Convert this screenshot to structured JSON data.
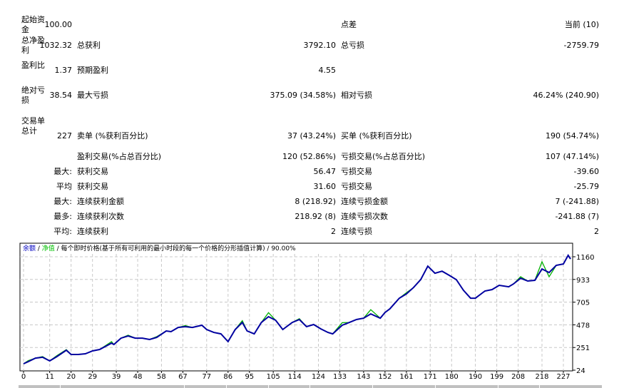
{
  "rows": [
    {
      "l1": "起始资金",
      "v1": "100.00",
      "l2": "",
      "v2": "",
      "l3": "点差",
      "v3": "当前 (10)"
    },
    {
      "l1": "总净盈利",
      "v1": "1032.32",
      "l2": "总获利",
      "v2": "3792.10",
      "l3": "总亏损",
      "v3": "-2759.79"
    },
    {
      "l1": "盈利比",
      "v1": "1.37",
      "l2": "预期盈利",
      "v2": "4.55",
      "l3": "",
      "v3": ""
    },
    {
      "l1": "绝对亏损",
      "v1": "38.54",
      "l2": "最大亏损",
      "v2": "375.09 (34.58%)",
      "l3": "相对亏损",
      "v3": "46.24% (240.90)"
    },
    {
      "l1": "交易单总计",
      "v1": "227",
      "l2": "卖单 (%获利百分比)",
      "v2": "37 (43.24%)",
      "l3": "买单 (%获利百分比)",
      "v3": "190 (54.74%)"
    },
    {
      "l1": "",
      "v1": "",
      "l2": "盈利交易(%占总百分比)",
      "v2": "120 (52.86%)",
      "l3": "亏损交易(%占总百分比)",
      "v3": "107 (47.14%)"
    },
    {
      "l1": "",
      "v1": "最大:",
      "l2": "获利交易",
      "v2": "56.47",
      "l3": "亏损交易",
      "v3": "-39.60"
    },
    {
      "l1": "",
      "v1": "平均",
      "l2": "获利交易",
      "v2": "31.60",
      "l3": "亏损交易",
      "v3": "-25.79"
    },
    {
      "l1": "",
      "v1": "最大:",
      "l2": "连续获利金额",
      "v2": "8 (218.92)",
      "l3": "连续亏损金额",
      "v3": "7 (-241.88)"
    },
    {
      "l1": "",
      "v1": "最多:",
      "l2": "连续获利次数",
      "v2": "218.92 (8)",
      "l3": "连续亏损次数",
      "v3": "-241.88 (7)"
    },
    {
      "l1": "",
      "v1": "平均:",
      "l2": "连续获利",
      "v2": "2",
      "l3": "连续亏损",
      "v3": "2"
    }
  ],
  "chart_data": {
    "type": "line",
    "legend": {
      "balance": "余额",
      "sep": " / ",
      "equity": "净值",
      "desc": " / 每个即时价格(基于所有可利用的最小时段的每一个价格的分形插值计算) / 90.00%"
    },
    "colors": {
      "balance": "#0000a0",
      "equity": "#00b000",
      "legend_balance": "#0000c0",
      "legend_equity": "#00c000"
    },
    "xticks": [
      0,
      11,
      20,
      29,
      39,
      48,
      58,
      67,
      77,
      86,
      95,
      105,
      114,
      124,
      133,
      143,
      152,
      161,
      171,
      180,
      190,
      199,
      208,
      218,
      227
    ],
    "yticks": [
      24,
      251,
      478,
      705,
      933,
      1160
    ],
    "xlim": [
      -1,
      230
    ],
    "ylim": [
      24,
      1190
    ],
    "balance": [
      [
        0,
        88
      ],
      [
        2,
        110
      ],
      [
        5,
        145
      ],
      [
        8,
        153
      ],
      [
        11,
        117
      ],
      [
        14,
        160
      ],
      [
        18,
        224
      ],
      [
        20,
        181
      ],
      [
        23,
        181
      ],
      [
        26,
        188
      ],
      [
        29,
        217
      ],
      [
        32,
        231
      ],
      [
        37,
        295
      ],
      [
        38,
        281
      ],
      [
        41,
        345
      ],
      [
        44,
        367
      ],
      [
        47,
        345
      ],
      [
        50,
        345
      ],
      [
        53,
        331
      ],
      [
        56,
        352
      ],
      [
        60,
        417
      ],
      [
        62,
        410
      ],
      [
        65,
        452
      ],
      [
        68,
        460
      ],
      [
        71,
        452
      ],
      [
        75,
        474
      ],
      [
        77,
        431
      ],
      [
        80,
        402
      ],
      [
        83,
        388
      ],
      [
        86,
        310
      ],
      [
        89,
        431
      ],
      [
        92,
        502
      ],
      [
        94,
        417
      ],
      [
        97,
        388
      ],
      [
        100,
        502
      ],
      [
        103,
        560
      ],
      [
        106,
        524
      ],
      [
        109,
        431
      ],
      [
        113,
        502
      ],
      [
        116,
        531
      ],
      [
        119,
        460
      ],
      [
        122,
        481
      ],
      [
        125,
        438
      ],
      [
        128,
        402
      ],
      [
        130,
        388
      ],
      [
        134,
        474
      ],
      [
        137,
        502
      ],
      [
        140,
        531
      ],
      [
        143,
        545
      ],
      [
        146,
        588
      ],
      [
        150,
        545
      ],
      [
        152,
        602
      ],
      [
        154,
        638
      ],
      [
        158,
        745
      ],
      [
        161,
        788
      ],
      [
        164,
        852
      ],
      [
        167,
        931
      ],
      [
        170,
        1066
      ],
      [
        173,
        995
      ],
      [
        176,
        1016
      ],
      [
        179,
        974
      ],
      [
        182,
        931
      ],
      [
        185,
        824
      ],
      [
        188,
        745
      ],
      [
        190,
        745
      ],
      [
        194,
        817
      ],
      [
        197,
        831
      ],
      [
        200,
        874
      ],
      [
        204,
        859
      ],
      [
        206,
        888
      ],
      [
        209,
        945
      ],
      [
        212,
        917
      ],
      [
        215,
        924
      ],
      [
        218,
        1038
      ],
      [
        221,
        1002
      ],
      [
        224,
        1074
      ],
      [
        227,
        1088
      ],
      [
        229,
        1174
      ],
      [
        230,
        1138
      ]
    ],
    "equity": [
      [
        0,
        88
      ],
      [
        2,
        120
      ],
      [
        5,
        145
      ],
      [
        8,
        160
      ],
      [
        11,
        117
      ],
      [
        14,
        170
      ],
      [
        18,
        230
      ],
      [
        20,
        181
      ],
      [
        23,
        181
      ],
      [
        26,
        188
      ],
      [
        29,
        217
      ],
      [
        32,
        231
      ],
      [
        37,
        310
      ],
      [
        38,
        281
      ],
      [
        41,
        345
      ],
      [
        44,
        375
      ],
      [
        47,
        345
      ],
      [
        50,
        345
      ],
      [
        53,
        331
      ],
      [
        56,
        360
      ],
      [
        60,
        417
      ],
      [
        62,
        410
      ],
      [
        65,
        452
      ],
      [
        68,
        470
      ],
      [
        71,
        452
      ],
      [
        75,
        474
      ],
      [
        77,
        431
      ],
      [
        80,
        402
      ],
      [
        83,
        388
      ],
      [
        86,
        310
      ],
      [
        89,
        431
      ],
      [
        92,
        520
      ],
      [
        94,
        417
      ],
      [
        97,
        388
      ],
      [
        100,
        502
      ],
      [
        103,
        600
      ],
      [
        106,
        524
      ],
      [
        109,
        431
      ],
      [
        113,
        502
      ],
      [
        116,
        540
      ],
      [
        119,
        460
      ],
      [
        122,
        481
      ],
      [
        125,
        438
      ],
      [
        128,
        402
      ],
      [
        130,
        388
      ],
      [
        134,
        500
      ],
      [
        137,
        502
      ],
      [
        140,
        531
      ],
      [
        143,
        545
      ],
      [
        146,
        630
      ],
      [
        150,
        545
      ],
      [
        152,
        602
      ],
      [
        154,
        638
      ],
      [
        158,
        745
      ],
      [
        161,
        800
      ],
      [
        164,
        852
      ],
      [
        167,
        931
      ],
      [
        170,
        1066
      ],
      [
        173,
        995
      ],
      [
        176,
        1016
      ],
      [
        179,
        974
      ],
      [
        182,
        931
      ],
      [
        185,
        824
      ],
      [
        188,
        745
      ],
      [
        190,
        745
      ],
      [
        194,
        817
      ],
      [
        197,
        831
      ],
      [
        200,
        874
      ],
      [
        204,
        859
      ],
      [
        206,
        888
      ],
      [
        209,
        960
      ],
      [
        212,
        917
      ],
      [
        215,
        924
      ],
      [
        218,
        1110
      ],
      [
        221,
        960
      ],
      [
        224,
        1074
      ],
      [
        227,
        1088
      ],
      [
        229,
        1174
      ],
      [
        230,
        1138
      ]
    ]
  }
}
